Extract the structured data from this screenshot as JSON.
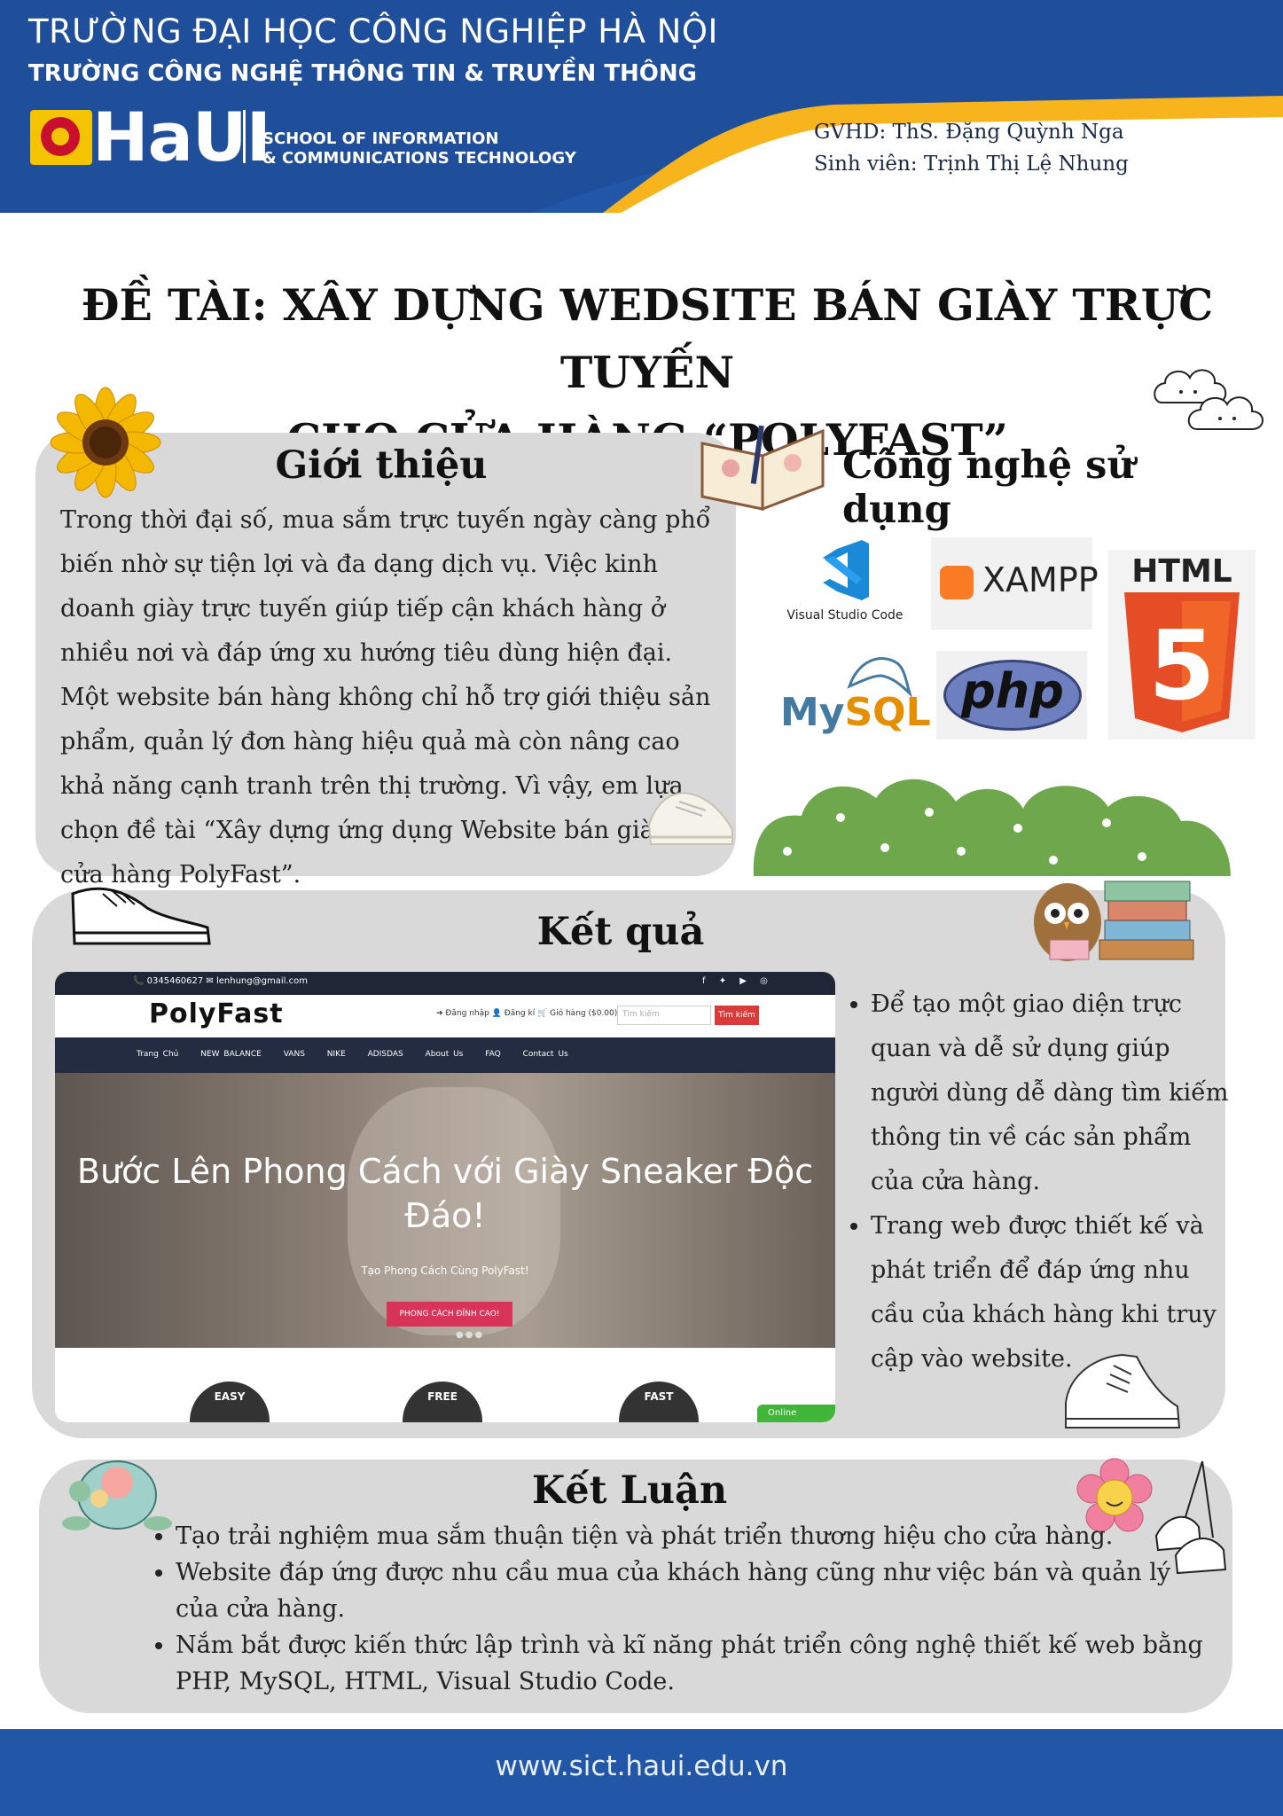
{
  "header": {
    "university": "TRƯỜNG ĐẠI HỌC CÔNG NGHIỆP HÀ NỘI",
    "school_vn": "TRƯỜNG CÔNG NGHỆ THÔNG TIN & TRUYỀN THÔNG",
    "brand": "HaUI",
    "school_en_line1": "SCHOOL OF INFORMATION",
    "school_en_line2": "& COMMUNICATIONS TECHNOLOGY",
    "supervisor": "GVHD: ThS. Đặng Quỳnh Nga",
    "student": "Sinh viên: Trịnh Thị Lệ Nhung"
  },
  "title": {
    "line1": "ĐỀ TÀI: XÂY DỰNG WEDSITE BÁN GIÀY TRỰC TUYẾN",
    "line2": "CHO CỬA HÀNG “POLYFAST”"
  },
  "intro": {
    "heading": "Giới thiệu",
    "text": "Trong thời đại số, mua sắm trực tuyến ngày càng phổ biến nhờ sự tiện lợi và đa dạng dịch vụ. Việc kinh doanh giày trực tuyến giúp tiếp cận khách hàng ở nhiều nơi và đáp ứng xu hướng tiêu dùng hiện đại. Một website bán hàng không chỉ hỗ trợ giới thiệu sản phẩm, quản lý đơn hàng hiệu quả mà còn nâng cao khả năng cạnh tranh trên thị trường. Vì vậy, em lựa chọn đề tài “Xây dựng ứng dụng Website bán giày cho cửa hàng PolyFast”."
  },
  "tech": {
    "heading": "Công nghệ sử dụng",
    "vscode": "Visual Studio Code",
    "xampp": "XAMPP",
    "html": "HTML",
    "html_digit": "5",
    "mysql_my": "My",
    "mysql_sql": "SQL",
    "php": "php"
  },
  "results": {
    "heading": "Kết quả",
    "bullets": [
      "Để tạo một giao diện trực quan và dễ sử dụng giúp người dùng dễ dàng tìm kiếm thông tin về các sản phẩm của cửa hàng.",
      "Trang web được thiết kế và phát triển để đáp ứng nhu cầu của khách hàng khi truy cập vào website."
    ],
    "screenshot": {
      "contact": "📞 0345460627   ✉ lenhung@gmail.com",
      "social": "f ✦ ▶ ◎",
      "logo": "PolyFast",
      "links": "➜ Đăng nhập   👤 Đăng kí   🛒 Giỏ hàng ($0.00)",
      "search_placeholder": "Tìm kiếm",
      "search_button": "Tìm kiếm",
      "nav": [
        "Trang Chủ",
        "NEW BALANCE",
        "VANS",
        "NIKE",
        "ADISDAS",
        "About Us",
        "FAQ",
        "Contact Us"
      ],
      "hero_title": "Bước Lên Phong Cách với Giày Sneaker Độc Đáo!",
      "hero_sub": "Tạo Phong Cách Cùng PolyFast!",
      "hero_button": "PHONG CÁCH ĐỈNH CAO!",
      "badges": [
        "EASY",
        "FREE",
        "FAST"
      ],
      "online": "Online"
    }
  },
  "conclusion": {
    "heading": "Kết Luận",
    "bullets": [
      "Tạo trải nghiệm mua sắm thuận tiện và phát triển thương hiệu cho cửa hàng.",
      "Website đáp ứng được nhu cầu mua của khách hàng cũng như việc bán và quản lý của cửa hàng.",
      "Nắm bắt được kiến thức lập trình và kĩ năng phát triển công nghệ thiết kế web bằng PHP, MySQL, HTML, Visual Studio Code."
    ]
  },
  "footer": {
    "url": "www.sict.haui.edu.vn"
  },
  "colors": {
    "brand_blue": "#2257a7",
    "accent_yellow": "#f8b41c",
    "panel_gray": "#d9d9d9"
  }
}
